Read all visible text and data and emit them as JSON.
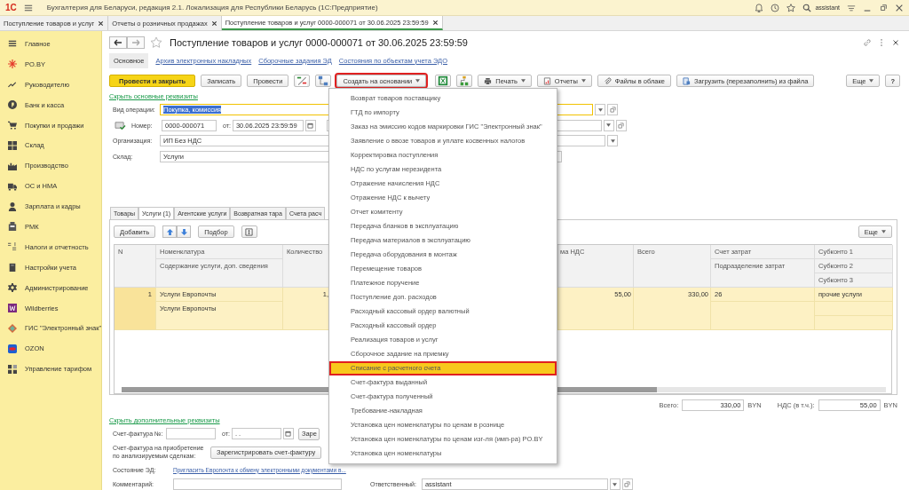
{
  "app": {
    "logo": "1С",
    "title": "Бухгалтерия для Беларуси, редакция 2.1. Локализация для Республики Беларусь  (1С:Предприятие)",
    "user": "assistant"
  },
  "open_windows": [
    {
      "label": "Поступление товаров и услуг",
      "selected": false
    },
    {
      "label": "Отчеты о розничных продажах",
      "selected": false
    },
    {
      "label": "Поступление товаров и услуг 0000-000071 от 30.06.2025 23:59:59",
      "selected": true
    }
  ],
  "sidebar": {
    "items": [
      {
        "label": "Главное"
      },
      {
        "label": "PO.BY"
      },
      {
        "label": "Руководителю"
      },
      {
        "label": "Банк и касса"
      },
      {
        "label": "Покупки и продажи"
      },
      {
        "label": "Склад"
      },
      {
        "label": "Производство"
      },
      {
        "label": "ОС и НМА"
      },
      {
        "label": "Зарплата и кадры"
      },
      {
        "label": "РМК"
      },
      {
        "label": "Налоги и отчетность"
      },
      {
        "label": "Настройки учета"
      },
      {
        "label": "Администрирование"
      },
      {
        "label": "Wildberries"
      },
      {
        "label": "ГИС \"Электронный знак\""
      },
      {
        "label": "OZON"
      },
      {
        "label": "Управление тарифом"
      }
    ]
  },
  "form": {
    "title": "Поступление товаров и услуг 0000-000071 от 30.06.2025 23:59:59",
    "nav": [
      {
        "label": "Основное",
        "selected": true
      },
      {
        "label": "Архив электронных накладных",
        "selected": false
      },
      {
        "label": "Сборочные задания ЭД",
        "selected": false
      },
      {
        "label": "Состояния по объектам учета ЭДО",
        "selected": false
      }
    ],
    "toolbar": [
      {
        "kind": "primary",
        "label": "Провести и закрыть"
      },
      {
        "kind": "button",
        "label": "Записать"
      },
      {
        "kind": "button",
        "label": "Провести"
      },
      {
        "kind": "icon"
      },
      {
        "kind": "icon"
      },
      {
        "kind": "menu",
        "label": "Создать на основании",
        "highlighted": true
      },
      {
        "kind": "icon"
      },
      {
        "kind": "icon"
      },
      {
        "kind": "menu",
        "label": "Печать",
        "highlighted": false
      },
      {
        "kind": "menu",
        "label": "Отчеты",
        "highlighted": false
      },
      {
        "kind": "button",
        "label": "Файлы в облаке"
      },
      {
        "kind": "button",
        "label": "Загрузить (перезаполнить) из файла"
      }
    ],
    "more": "Еще",
    "help": "?",
    "hide_main_link": "Скрыть основные реквизиты",
    "operation": {
      "label": "Вид операции:",
      "value": "Покупка, комиссия"
    },
    "number": {
      "label": "Номер:",
      "value": "0000-000071"
    },
    "date": {
      "label": "от:",
      "value": "30.06.2025 23:59:59"
    },
    "organization": {
      "label": "Организация:",
      "value": "ИП Без НДС"
    },
    "warehouse": {
      "label": "Склад:",
      "value": "Услуги"
    },
    "tabs": [
      {
        "label": "Товары",
        "selected": false
      },
      {
        "label": "Услуги (1)",
        "selected": true
      },
      {
        "label": "Агентские услуги",
        "selected": false
      },
      {
        "label": "Возвратная тара",
        "selected": false
      },
      {
        "label": "Счета расч",
        "selected": false
      }
    ],
    "table_commands": {
      "add": "Добавить",
      "pick": "Подбор",
      "more": "Еще"
    },
    "columns": {
      "n": "N",
      "item": "Номенклатура",
      "content": "Содержание услуги, доп. сведения",
      "quantity": "Количество",
      "vat": "ма НДС",
      "total": "Всего",
      "cost_account": "Счет затрат",
      "cost_department": "Подразделение затрат",
      "subconto_1": "Субконто 1",
      "subconto_2": "Субконто 2",
      "subconto_3": "Субконто 3"
    },
    "rows": [
      {
        "n": "1",
        "item": "Услуги Европочты",
        "content": "Услуги Европочты",
        "quantity": "1,",
        "vat": "55,00",
        "total": "330,00",
        "cost_account": "26",
        "subconto_1": "прочие услуги",
        "selected": true
      }
    ],
    "totals": {
      "total_label": "Всего:",
      "total": "330,00",
      "total_currency": "BYN",
      "vat_label": "НДС (в т.ч.):",
      "vat": "55,00",
      "vat_currency": "BYN"
    },
    "hide_extra_link": "Скрыть дополнительные реквизиты",
    "invoice": {
      "label": "Счет-фактура №:",
      "date_label": "от:",
      "date_value": " .  . ",
      "register_cut": "Заре"
    },
    "invoice_acquire": {
      "label": "Счет-фактура на приобретение по анализируемым сделкам:",
      "button": "Зарегистрировать счет-фактуру"
    },
    "ed_state": {
      "label": "Состояние ЭД:",
      "link": "Пригласить Европочта к обмену электронными документами в..."
    },
    "comment": {
      "label": "Комментарий:"
    },
    "responsible": {
      "label": "Ответственный:",
      "value": "assistant"
    }
  },
  "create_menu": {
    "items": [
      {
        "label": "Возврат товаров поставщику",
        "selected": false
      },
      {
        "label": "ГТД по импорту",
        "selected": false
      },
      {
        "label": "Заказ на эмиссию кодов маркировки ГИС \"Электронный знак\"",
        "selected": false
      },
      {
        "label": "Заявление о ввозе товаров и уплате косвенных налогов",
        "selected": false
      },
      {
        "label": "Корректировка поступления",
        "selected": false
      },
      {
        "label": "НДС по услугам нерезидента",
        "selected": false
      },
      {
        "label": "Отражение начисления НДС",
        "selected": false
      },
      {
        "label": "Отражение НДС к вычету",
        "selected": false
      },
      {
        "label": "Отчет комитенту",
        "selected": false
      },
      {
        "label": "Передача бланков в эксплуатацию",
        "selected": false
      },
      {
        "label": "Передача материалов в эксплуатацию",
        "selected": false
      },
      {
        "label": "Передача оборудования в монтаж",
        "selected": false
      },
      {
        "label": "Перемещение товаров",
        "selected": false
      },
      {
        "label": "Платежное поручение",
        "selected": false
      },
      {
        "label": "Поступление доп. расходов",
        "selected": false
      },
      {
        "label": "Расходный кассовый ордер валютный",
        "selected": false
      },
      {
        "label": "Расходный кассовый ордер",
        "selected": false
      },
      {
        "label": "Реализация товаров и услуг",
        "selected": false
      },
      {
        "label": "Сборочное задание на приемку",
        "selected": false
      },
      {
        "label": "Списание с расчетного счета",
        "selected": true
      },
      {
        "label": "Счет-фактура выданный",
        "selected": false
      },
      {
        "label": "Счет-фактура полученный",
        "selected": false
      },
      {
        "label": "Требование-накладная",
        "selected": false
      },
      {
        "label": "Установка цен номенклатуры по ценам в рознице",
        "selected": false
      },
      {
        "label": "Установка цен номенклатуры по ценам изг-ля (имп-ра) PO.BY",
        "selected": false
      },
      {
        "label": "Установка цен номенклатуры",
        "selected": false
      }
    ]
  }
}
